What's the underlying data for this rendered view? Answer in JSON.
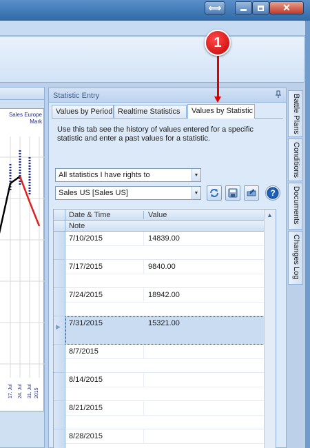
{
  "window": {
    "resize_icon": "resize-horizontal-icon",
    "minimize_icon": "minimize-icon",
    "maximize_icon": "maximize-icon",
    "close_icon": "close-icon",
    "close_glyph": "✕",
    "resize_glyph": "⟺"
  },
  "callout": {
    "number": "1"
  },
  "chart": {
    "legend_line1": "Sales Europe",
    "legend_line2": "Mark",
    "tick_labels": [
      "17. Jul",
      "24. Jul",
      "31. Jul",
      "2015"
    ]
  },
  "panel": {
    "title": "Statistic Entry",
    "tabs": [
      "Values by Period",
      "Realtime Statistics",
      "Values by Statistic"
    ],
    "active_tab": "Values by Statistic",
    "description": "Use this tab see the history of values entered for a specific statistic and enter a past values for a statistic.",
    "filter_combo": {
      "value": "All statistics I have rights to"
    },
    "statistic_combo": {
      "value": "Sales US [Sales US]"
    },
    "toolbar_icons": [
      "refresh-icon",
      "save-icon",
      "export-icon",
      "help-icon"
    ],
    "grid": {
      "columns": [
        "Date & Time",
        "Value"
      ],
      "subheader": "Note",
      "rows": [
        {
          "date": "7/10/2015",
          "value": "14839.00"
        },
        {
          "date": "7/17/2015",
          "value": "9840.00"
        },
        {
          "date": "7/24/2015",
          "value": "18942.00"
        },
        {
          "date": "7/31/2015",
          "value": "15321.00",
          "selected": true
        },
        {
          "date": "8/7/2015",
          "value": ""
        },
        {
          "date": "8/14/2015",
          "value": ""
        },
        {
          "date": "8/21/2015",
          "value": ""
        },
        {
          "date": "8/28/2015",
          "value": ""
        }
      ]
    }
  },
  "side_tabs": [
    "Battle Plans",
    "Conditions",
    "Documents",
    "Changes Log"
  ],
  "colors": {
    "accent": "#2f6aa8",
    "callout": "#d00000",
    "chart_line_black": "#000000",
    "chart_line_red": "#e02020"
  }
}
